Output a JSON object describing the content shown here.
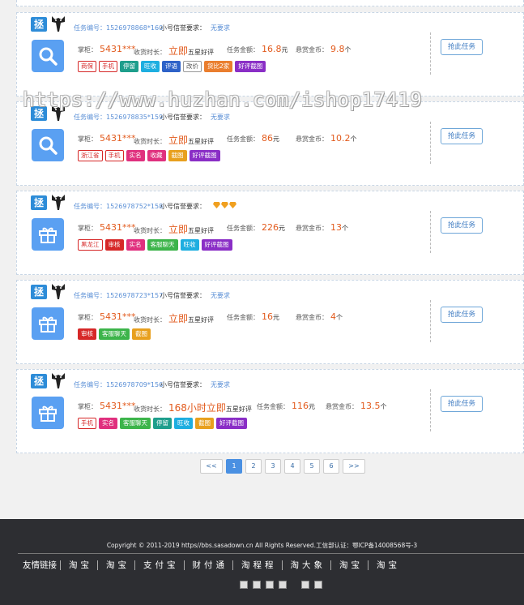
{
  "labels": {
    "task_no": "任务编号：",
    "credit_req": "小号信誉要求：",
    "shop": "掌柜：",
    "time": "收货时长：",
    "amount": "任务金额：",
    "reward": "悬赏金币：",
    "grab": "抢此任务"
  },
  "platform_logo": "拯",
  "colors": {
    "accent": "#4a90e2",
    "price": "#e25a1c",
    "footer": "#2d2e32"
  },
  "watermark": "https://www.huzhan.com/ishop17419",
  "tasks": [
    {
      "id": "1526978868*160",
      "credit": "无要求",
      "icon": "search-icon",
      "shop": "5431***",
      "time": "立即",
      "time_suffix": "五星好评",
      "amount": "16.8",
      "amount_unit": "元",
      "reward": "9.8",
      "reward_unit": "个",
      "tags": [
        {
          "t": "商保",
          "c": "red"
        },
        {
          "t": "手机",
          "c": "red"
        },
        {
          "t": "停留",
          "c": "teal"
        },
        {
          "t": "旺收",
          "c": "cyan"
        },
        {
          "t": "评语",
          "c": "blue"
        },
        {
          "t": "改价",
          "c": "gray"
        },
        {
          "t": "货比2家",
          "c": "orange"
        },
        {
          "t": "好评截图",
          "c": "purple"
        }
      ]
    },
    {
      "id": "1526978835*159",
      "credit": "无要求",
      "icon": "search-icon",
      "shop": "5431***",
      "time": "立即",
      "time_suffix": "五星好评",
      "amount": "86",
      "amount_unit": "元",
      "reward": "10.2",
      "reward_unit": "个",
      "tags": [
        {
          "t": "浙江省",
          "c": "red"
        },
        {
          "t": "手机",
          "c": "red"
        },
        {
          "t": "实名",
          "c": "pink"
        },
        {
          "t": "收藏",
          "c": "pink"
        },
        {
          "t": "截图",
          "c": "amber"
        },
        {
          "t": "好评截图",
          "c": "purple"
        }
      ]
    },
    {
      "id": "1526978752*158",
      "credit": "",
      "gems": 3,
      "icon": "gift-icon",
      "shop": "5431***",
      "time": "立即",
      "time_suffix": "五星好评",
      "amount": "226",
      "amount_unit": "元",
      "reward": "13",
      "reward_unit": "个",
      "tags": [
        {
          "t": "黑龙江",
          "c": "red"
        },
        {
          "t": "审核",
          "c": "redf"
        },
        {
          "t": "实名",
          "c": "pink"
        },
        {
          "t": "客服聊天",
          "c": "green"
        },
        {
          "t": "旺收",
          "c": "cyan"
        },
        {
          "t": "好评截图",
          "c": "purple"
        }
      ]
    },
    {
      "id": "1526978723*157",
      "credit": "无要求",
      "icon": "gift-icon",
      "shop": "5431***",
      "time": "立即",
      "time_suffix": "五星好评",
      "amount": "16",
      "amount_unit": "元",
      "reward": "4",
      "reward_unit": "个",
      "tags": [
        {
          "t": "审核",
          "c": "redf"
        },
        {
          "t": "客服聊天",
          "c": "green"
        },
        {
          "t": "截图",
          "c": "amber"
        }
      ]
    },
    {
      "id": "1526978709*156",
      "credit": "无要求",
      "icon": "gift-icon",
      "shop": "5431***",
      "time": "168小时立即",
      "time_suffix": "五星好评",
      "amount": "116",
      "amount_unit": "元",
      "reward": "13.5",
      "reward_unit": "个",
      "tags": [
        {
          "t": "手机",
          "c": "red"
        },
        {
          "t": "实名",
          "c": "pink"
        },
        {
          "t": "客服聊天",
          "c": "green"
        },
        {
          "t": "停留",
          "c": "teal"
        },
        {
          "t": "旺收",
          "c": "cyan"
        },
        {
          "t": "截图",
          "c": "amber"
        },
        {
          "t": "好评截图",
          "c": "purple"
        }
      ]
    }
  ],
  "pagination": {
    "prev": "<<",
    "pages": [
      "1",
      "2",
      "3",
      "4",
      "5",
      "6"
    ],
    "current": "1",
    "next": ">>"
  },
  "footer": {
    "copyright": "Copyright © 2011-2019 https//bbs.sasadown.cn All Rights Reserved.工信部认证：鄂ICP备14008568号-3",
    "links_title": "友情链接",
    "links": [
      "淘宝",
      "淘宝",
      "支付宝",
      "财付通",
      "淘程程",
      "淘大象",
      "淘宝",
      "淘宝"
    ]
  }
}
